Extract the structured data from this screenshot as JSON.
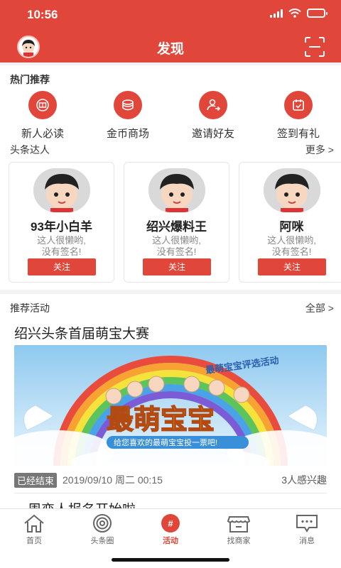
{
  "status": {
    "time": "10:56"
  },
  "nav": {
    "title": "发现"
  },
  "hot": {
    "title": "热门推荐",
    "items": [
      {
        "label": "新人必读",
        "icon": "book-icon"
      },
      {
        "label": "金币商场",
        "icon": "coins-icon"
      },
      {
        "label": "邀请好友",
        "icon": "invite-user-icon"
      },
      {
        "label": "签到有礼",
        "icon": "calendar-check-icon"
      }
    ]
  },
  "experts": {
    "title": "头条达人",
    "more": "更多 >",
    "cards": [
      {
        "name": "93年小白羊",
        "sig1": "这人很懒哟,",
        "sig2": "没有签名!",
        "follow": "关注"
      },
      {
        "name": "绍兴爆料王",
        "sig1": "这人很懒哟,",
        "sig2": "没有签名!",
        "follow": "关注"
      },
      {
        "name": "阿咪",
        "sig1": "这人很懒哟,",
        "sig2": "没有签名!",
        "follow": "关注"
      }
    ]
  },
  "activities": {
    "title": "推荐活动",
    "all": "全部 >",
    "item": {
      "title": "绍兴头条首届萌宝大赛",
      "banner_top": "最萌宝宝评选活动",
      "banner_main": "最萌宝宝",
      "banner_sub": "给您喜欢的最萌宝宝投一票吧!",
      "status": "已经结束",
      "date": "2019/09/10 周二 00:15",
      "interest": "3人感兴趣"
    },
    "next_title": "一周恋人报名开始啦"
  },
  "tabs": [
    {
      "label": "首页",
      "icon": "home-icon"
    },
    {
      "label": "头条圈",
      "icon": "target-icon"
    },
    {
      "label": "活动",
      "icon": "hash-icon"
    },
    {
      "label": "找商家",
      "icon": "store-icon"
    },
    {
      "label": "消息",
      "icon": "chat-icon"
    }
  ],
  "colors": {
    "brand": "#e0463a",
    "background": "#f2f2f2"
  }
}
